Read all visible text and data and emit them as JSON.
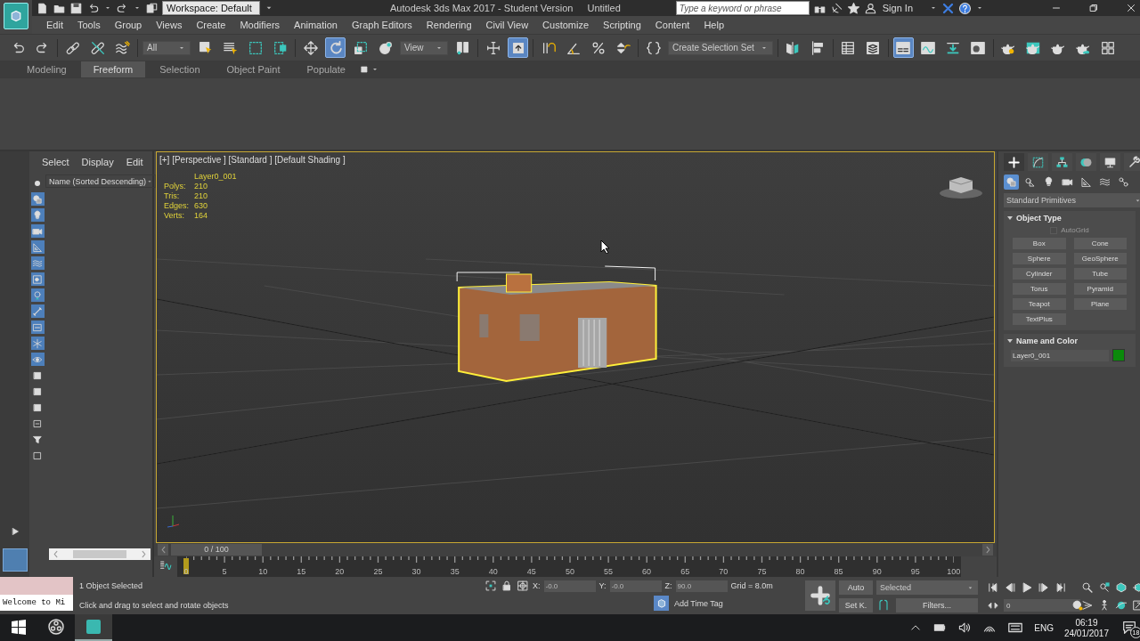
{
  "title_bar": {
    "workspace": "Workspace: Default",
    "title": "Autodesk 3ds Max 2017 - Student Version",
    "document": "Untitled",
    "search": {
      "placeholder": "Type a keyword or phrase"
    },
    "sign_in": "Sign In"
  },
  "menu": [
    "Edit",
    "Tools",
    "Group",
    "Views",
    "Create",
    "Modifiers",
    "Animation",
    "Graph Editors",
    "Rendering",
    "Civil View",
    "Customize",
    "Scripting",
    "Content",
    "Help"
  ],
  "toolbar": [
    {
      "kind": "undo",
      "selected": false
    },
    {
      "kind": "redo",
      "selected": false
    },
    {
      "kind": "separator"
    },
    {
      "kind": "link",
      "selected": false
    },
    {
      "kind": "unlink",
      "selected": false
    },
    {
      "kind": "bind",
      "selected": false
    },
    {
      "kind": "separator"
    },
    {
      "kind": "dropdown",
      "label": "All"
    },
    {
      "kind": "select",
      "selected": false
    },
    {
      "kind": "selectname",
      "selected": false
    },
    {
      "kind": "rectsel",
      "selected": false
    },
    {
      "kind": "crossing",
      "selected": false
    },
    {
      "kind": "separator"
    },
    {
      "kind": "move",
      "selected": false
    },
    {
      "kind": "rotate",
      "selected": true
    },
    {
      "kind": "scale",
      "selected": false
    },
    {
      "kind": "place",
      "selected": false
    },
    {
      "kind": "dropdown",
      "label": "View"
    },
    {
      "kind": "pivot",
      "selected": false
    },
    {
      "kind": "separator"
    },
    {
      "kind": "manip",
      "selected": false
    },
    {
      "kind": "shortcut",
      "selected": true
    },
    {
      "kind": "separator"
    },
    {
      "kind": "snap",
      "selected": false
    },
    {
      "kind": "anglesnap",
      "selected": false
    },
    {
      "kind": "percent",
      "selected": false
    },
    {
      "kind": "spinner",
      "selected": false
    },
    {
      "kind": "separator"
    },
    {
      "kind": "named",
      "selected": false
    },
    {
      "kind": "dropdown",
      "label": "Create Selection Set"
    },
    {
      "kind": "separator"
    },
    {
      "kind": "mirror",
      "selected": false
    },
    {
      "kind": "align",
      "selected": false
    },
    {
      "kind": "separator"
    },
    {
      "kind": "table",
      "selected": false
    },
    {
      "kind": "layers",
      "selected": false
    },
    {
      "kind": "separator"
    },
    {
      "kind": "ribbon",
      "selected": true
    },
    {
      "kind": "curve",
      "selected": false
    },
    {
      "kind": "schematic",
      "selected": false
    },
    {
      "kind": "material",
      "selected": false
    },
    {
      "kind": "separator"
    },
    {
      "kind": "rendersetup",
      "selected": false
    },
    {
      "kind": "framewin",
      "selected": false
    },
    {
      "kind": "render",
      "selected": false
    },
    {
      "kind": "cloud",
      "selected": false
    },
    {
      "kind": "quad",
      "selected": false
    }
  ],
  "ribbon_tabs": [
    {
      "label": "Modeling",
      "selected": false
    },
    {
      "label": "Freeform",
      "selected": true
    },
    {
      "label": "Selection",
      "selected": false
    },
    {
      "label": "Object Paint",
      "selected": false
    },
    {
      "label": "Populate",
      "selected": false
    }
  ],
  "scene_explorer": {
    "tabs": [
      "Select",
      "Display",
      "Edit"
    ],
    "column": "Name (Sorted Descending)",
    "filters": [
      {
        "kind": "dot",
        "on": false
      },
      {
        "kind": "geometry",
        "on": true
      },
      {
        "kind": "light",
        "on": true
      },
      {
        "kind": "camera",
        "on": true
      },
      {
        "kind": "helper",
        "on": true
      },
      {
        "kind": "spacewarp",
        "on": true
      },
      {
        "kind": "group",
        "on": true
      },
      {
        "kind": "xref",
        "on": true
      },
      {
        "kind": "bone",
        "on": true
      },
      {
        "kind": "container",
        "on": true
      },
      {
        "kind": "frozen",
        "on": true
      },
      {
        "kind": "hidden",
        "on": true
      },
      {
        "kind": "square",
        "on": false
      },
      {
        "kind": "square",
        "on": false
      },
      {
        "kind": "square",
        "on": false
      },
      {
        "kind": "filter",
        "on": false
      },
      {
        "kind": "funnel",
        "on": false
      },
      {
        "kind": "frame",
        "on": false
      }
    ]
  },
  "viewport": {
    "label": "[+] [Perspective ] [Standard ] [Default Shading ]",
    "object": "Layer0_001",
    "stats": [
      {
        "label": "Polys:",
        "value": "210"
      },
      {
        "label": "Tris:",
        "value": "210"
      },
      {
        "label": "Edges:",
        "value": "630"
      },
      {
        "label": "Verts:",
        "value": "164"
      }
    ]
  },
  "command_panel": {
    "tabs": [
      {
        "kind": "create",
        "selected": true
      },
      {
        "kind": "modify",
        "selected": false
      },
      {
        "kind": "hierarchy",
        "selected": false
      },
      {
        "kind": "motion",
        "selected": false
      },
      {
        "kind": "display",
        "selected": false
      },
      {
        "kind": "utilities",
        "selected": false
      }
    ],
    "categories": [
      {
        "kind": "geometry",
        "selected": true
      },
      {
        "kind": "shapes",
        "selected": false
      },
      {
        "kind": "light",
        "selected": false
      },
      {
        "kind": "camera",
        "selected": false
      },
      {
        "kind": "helper",
        "selected": false
      },
      {
        "kind": "spacewarp",
        "selected": false
      },
      {
        "kind": "systems",
        "selected": false
      }
    ],
    "type_dropdown": "Standard Primitives",
    "object_type": {
      "title": "Object Type",
      "autogrid": {
        "label": "AutoGrid",
        "checked": false,
        "disabled": true
      },
      "buttons": [
        "Box",
        "Cone",
        "Sphere",
        "GeoSphere",
        "Cylinder",
        "Tube",
        "Torus",
        "Pyramid",
        "Teapot",
        "Plane",
        "TextPlus"
      ]
    },
    "name_color": {
      "title": "Name and Color",
      "name": "Layer0_001",
      "color": "#0b8a0b"
    }
  },
  "time_slider": {
    "label": "0 / 100",
    "level": 0
  },
  "track_bar": {
    "labels": [
      "0",
      "5",
      "10",
      "15",
      "20",
      "25",
      "30",
      "35",
      "40",
      "45",
      "50",
      "55",
      "60",
      "65",
      "70",
      "75",
      "80",
      "85",
      "90",
      "95",
      "100"
    ]
  },
  "listener": {
    "output": "Welcome to Mi"
  },
  "status": {
    "selection": "1 Object Selected",
    "prompt": "Click and drag to select and rotate objects",
    "coords": [
      {
        "label": "X:",
        "value": "-0.0"
      },
      {
        "label": "Y:",
        "value": "-0.0"
      },
      {
        "label": "Z:",
        "value": "90.0"
      }
    ],
    "grid": "Grid = 8.0m",
    "time_tag": "Add Time Tag"
  },
  "animation": {
    "auto": "Auto",
    "set_key": "Set K.",
    "key_filter": "Selected",
    "filters": "Filters...",
    "frame": "0"
  },
  "taskbar": {
    "apps": [
      {
        "kind": "windows",
        "selected": false
      },
      {
        "kind": "obs",
        "selected": false
      },
      {
        "kind": "max",
        "selected": true
      }
    ],
    "language": "ENG",
    "time": "06:19",
    "date": "24/01/2017",
    "notifications": "18"
  }
}
